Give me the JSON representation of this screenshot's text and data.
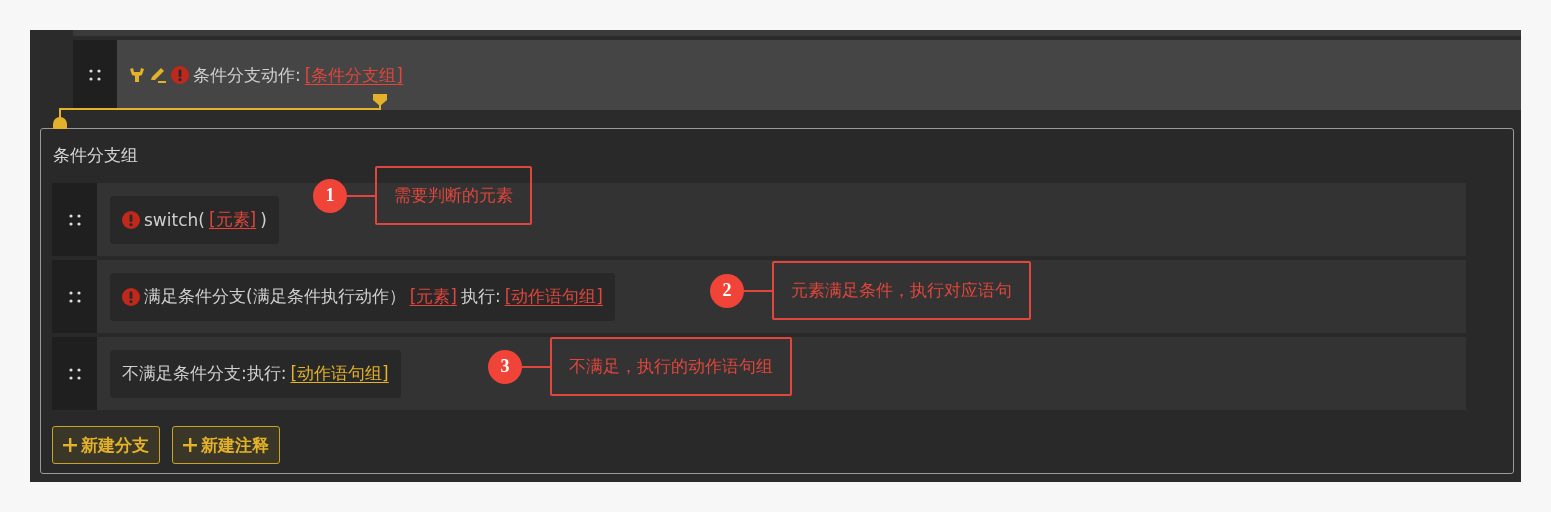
{
  "header": {
    "warning": true,
    "label": "条件分支动作:",
    "link": {
      "text": "[条件分支组]",
      "error": true
    }
  },
  "panel": {
    "title": "条件分支组",
    "rows": [
      {
        "warning": true,
        "segments": [
          {
            "kind": "text",
            "text": "switch("
          },
          {
            "kind": "link",
            "text": "[元素]",
            "error": true
          },
          {
            "kind": "text",
            "text": ")"
          }
        ],
        "callout": {
          "number": "1",
          "text": "需要判断的元素"
        }
      },
      {
        "warning": true,
        "segments": [
          {
            "kind": "text",
            "text": "满足条件分支(满足条件执行动作）"
          },
          {
            "kind": "link",
            "text": "[元素]",
            "error": true
          },
          {
            "kind": "text",
            "text": "执行:"
          },
          {
            "kind": "link",
            "text": "[动作语句组]",
            "error": true
          }
        ],
        "callout": {
          "number": "2",
          "text": "元素满足条件，执行对应语句"
        }
      },
      {
        "warning": false,
        "segments": [
          {
            "kind": "text",
            "text": "不满足条件分支:执行:"
          },
          {
            "kind": "link",
            "text": "[动作语句组]",
            "error": false
          }
        ],
        "callout": {
          "number": "3",
          "text": "不满足，执行的动作语句组"
        }
      }
    ],
    "buttons": [
      {
        "label": "新建分支"
      },
      {
        "label": "新建注释"
      }
    ]
  }
}
